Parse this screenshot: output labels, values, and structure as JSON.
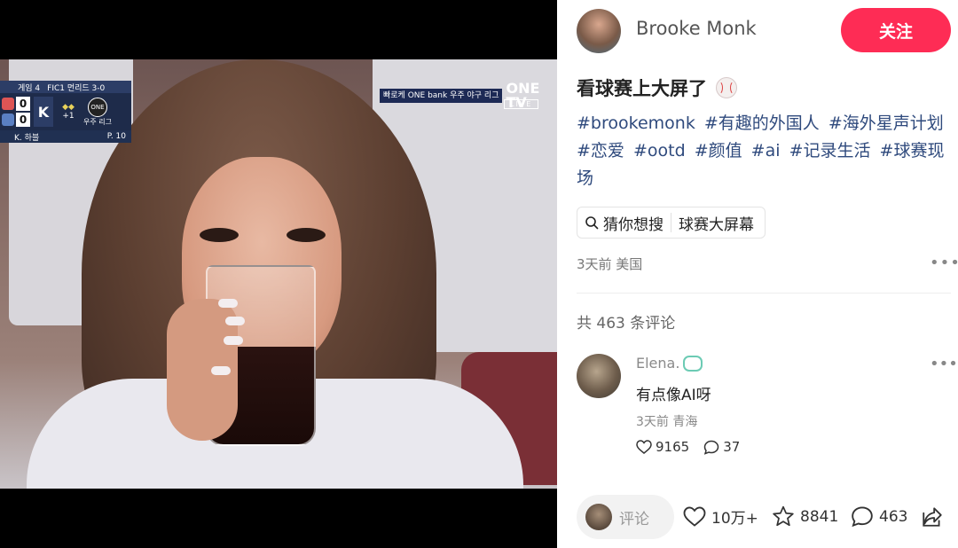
{
  "video": {
    "scoreboard": {
      "top": [
        "게임 4",
        "FIC1 먼리드 3-0"
      ],
      "scores": [
        "0",
        "0"
      ],
      "count": "K",
      "outs": "+1",
      "network": "우주 리그",
      "bottom_left": "K. 하블",
      "bottom_right": "P. 10"
    },
    "broadcast": {
      "ticker": "빠로케 ONE bank 우주 야구 리그",
      "logo": "ONE TV",
      "live": "LIVE"
    }
  },
  "author": {
    "name": "Brooke Monk",
    "follow_label": "关注"
  },
  "post": {
    "title": "看球赛上大屏了",
    "tags": [
      "#brookemonk",
      "#有趣的外国人",
      "#海外星声计划",
      "#恋爱",
      "#ootd",
      "#颜值",
      "#ai",
      "#记录生活",
      "#球赛现场"
    ],
    "search_label": "猜你想搜",
    "search_term": "球赛大屏幕",
    "meta": "3天前 美国",
    "comment_count_label": "共 463 条评论"
  },
  "comment": {
    "name": "Elena.",
    "text": "有点像AI呀",
    "meta": "3天前 青海",
    "likes": "9165",
    "replies": "37"
  },
  "bottom": {
    "input_placeholder": "评论",
    "likes": "10万+",
    "favorites": "8841",
    "comments": "463"
  },
  "colors": {
    "accent": "#fe2c55",
    "tag": "#2f4a7d"
  }
}
